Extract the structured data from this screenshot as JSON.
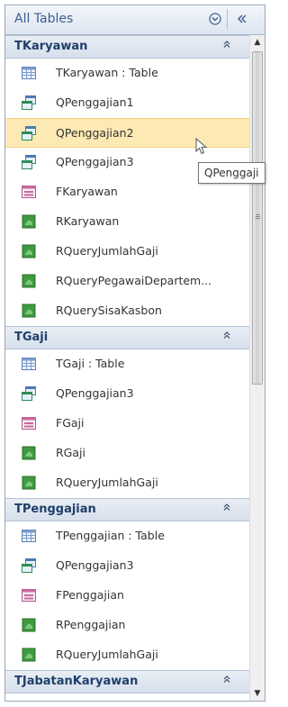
{
  "header": {
    "title": "All Tables",
    "menu_icon": "dropdown-circle-icon",
    "collapse_icon": "double-chevron-left-icon"
  },
  "groups": [
    {
      "label": "TKaryawan",
      "items": [
        {
          "label": "TKaryawan : Table",
          "icon": "table-icon"
        },
        {
          "label": "QPenggajian1",
          "icon": "query-icon"
        },
        {
          "label": "QPenggajian2",
          "icon": "query-icon",
          "selected": true
        },
        {
          "label": "QPenggajian3",
          "icon": "query-icon"
        },
        {
          "label": "FKaryawan",
          "icon": "form-icon"
        },
        {
          "label": "RKaryawan",
          "icon": "report-icon"
        },
        {
          "label": "RQueryJumlahGaji",
          "icon": "report-icon"
        },
        {
          "label": "RQueryPegawaiDepartem...",
          "icon": "report-icon"
        },
        {
          "label": "RQuerySisaKasbon",
          "icon": "report-icon"
        }
      ]
    },
    {
      "label": "TGaji",
      "items": [
        {
          "label": "TGaji : Table",
          "icon": "table-icon"
        },
        {
          "label": "QPenggajian3",
          "icon": "query-icon"
        },
        {
          "label": "FGaji",
          "icon": "form-icon"
        },
        {
          "label": "RGaji",
          "icon": "report-icon"
        },
        {
          "label": "RQueryJumlahGaji",
          "icon": "report-icon"
        }
      ]
    },
    {
      "label": "TPenggajian",
      "items": [
        {
          "label": "TPenggajian : Table",
          "icon": "table-icon"
        },
        {
          "label": "QPenggajian3",
          "icon": "query-icon"
        },
        {
          "label": "FPenggajian",
          "icon": "form-icon"
        },
        {
          "label": "RPenggajian",
          "icon": "report-icon"
        },
        {
          "label": "RQueryJumlahGaji",
          "icon": "report-icon"
        }
      ]
    },
    {
      "label": "TJabatanKaryawan",
      "items": []
    }
  ],
  "tooltip": {
    "text": "QPenggaji"
  },
  "colors": {
    "selected_bg": "#fde9b4",
    "header_text": "#3a5f93",
    "group_text": "#1f3f6b"
  }
}
